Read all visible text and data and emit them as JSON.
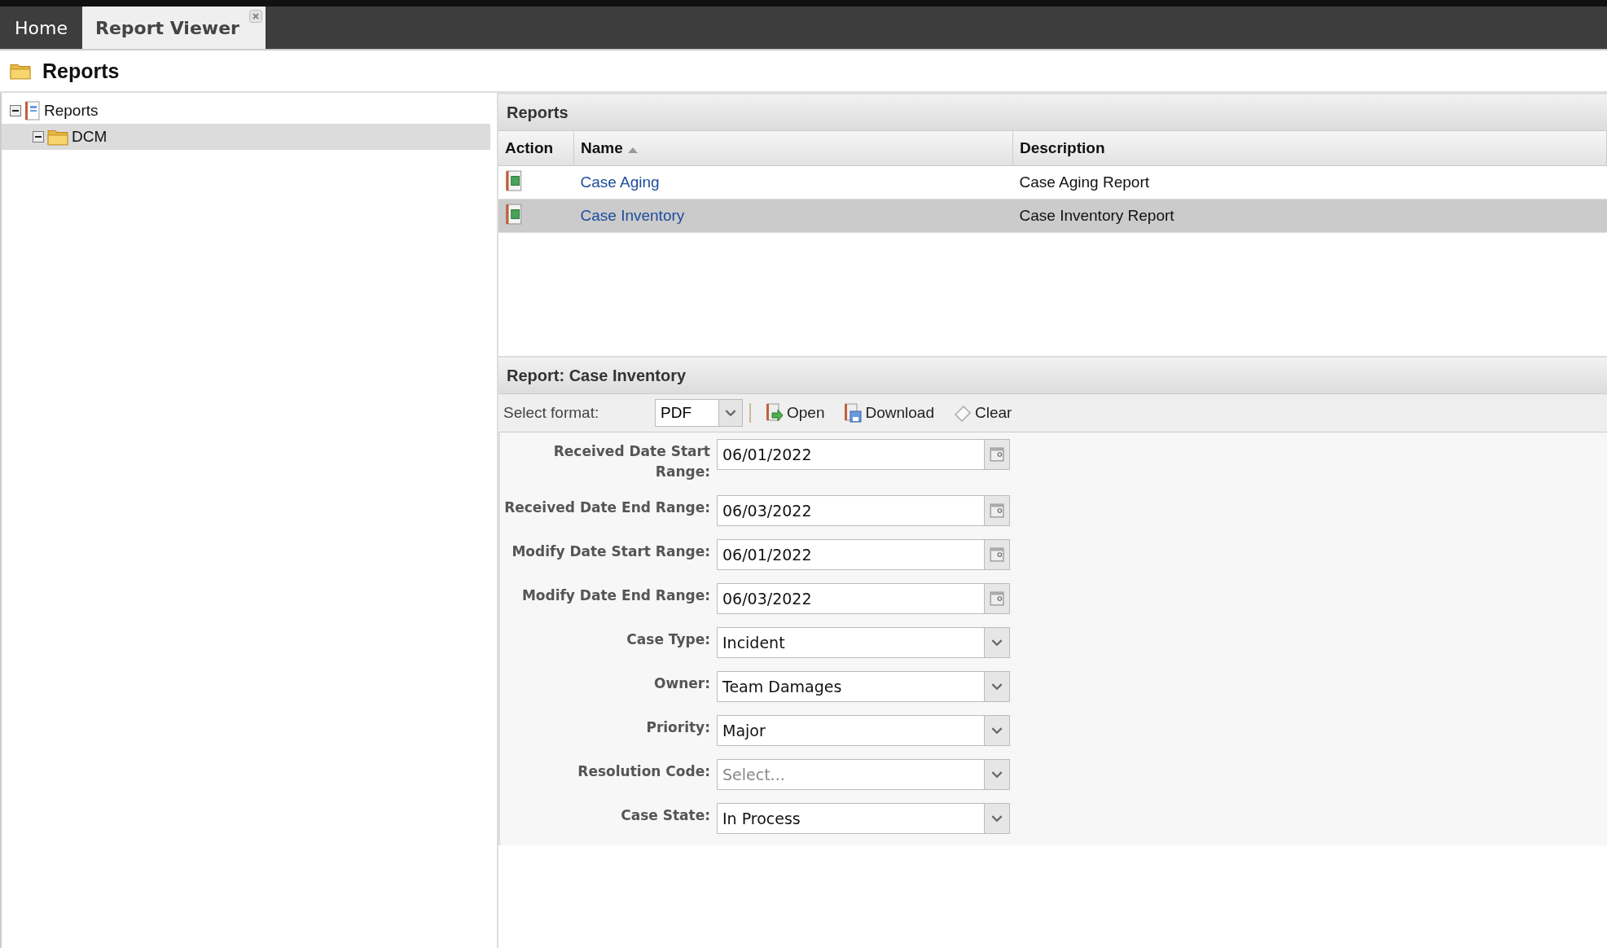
{
  "tabs": [
    {
      "label": "Home",
      "selected": false,
      "closable": false
    },
    {
      "label": "Report Viewer",
      "selected": true,
      "closable": true
    }
  ],
  "page_title": "Reports",
  "tree": [
    {
      "label": "Reports",
      "kind": "report",
      "expanded": true,
      "selected": false,
      "children": [
        {
          "label": "DCM",
          "kind": "folder",
          "expanded": true,
          "selected": true
        }
      ]
    }
  ],
  "reports_panel": {
    "title": "Reports",
    "columns": [
      {
        "label": "Action",
        "sorted": false
      },
      {
        "label": "Name",
        "sorted": true
      },
      {
        "label": "Description",
        "sorted": false
      }
    ],
    "rows": [
      {
        "name": "Case Aging",
        "description": "Case Aging Report",
        "selected": false
      },
      {
        "name": "Case Inventory",
        "description": "Case Inventory Report",
        "selected": true
      }
    ]
  },
  "report_form": {
    "title": "Report: Case Inventory",
    "format_label": "Select format:",
    "format": "PDF",
    "actions": [
      {
        "kind": "open",
        "label": "Open"
      },
      {
        "kind": "download",
        "label": "Download"
      },
      {
        "kind": "clear",
        "label": "Clear"
      }
    ],
    "fields": [
      {
        "label": "Received Date Start Range:",
        "kind": "date",
        "value": "06/01/2022"
      },
      {
        "label": "Received Date End Range:",
        "kind": "date",
        "value": "06/03/2022"
      },
      {
        "label": "Modify Date Start Range:",
        "kind": "date",
        "value": "06/01/2022"
      },
      {
        "label": "Modify Date End Range:",
        "kind": "date",
        "value": "06/03/2022"
      },
      {
        "label": "Case Type:",
        "kind": "select",
        "value": "Incident"
      },
      {
        "label": "Owner:",
        "kind": "select",
        "value": "Team Damages"
      },
      {
        "label": "Priority:",
        "kind": "select",
        "value": "Major"
      },
      {
        "label": "Resolution Code:",
        "kind": "select",
        "placeholder": "Select..."
      },
      {
        "label": "Case State:",
        "kind": "select",
        "value": "In Process"
      }
    ]
  }
}
